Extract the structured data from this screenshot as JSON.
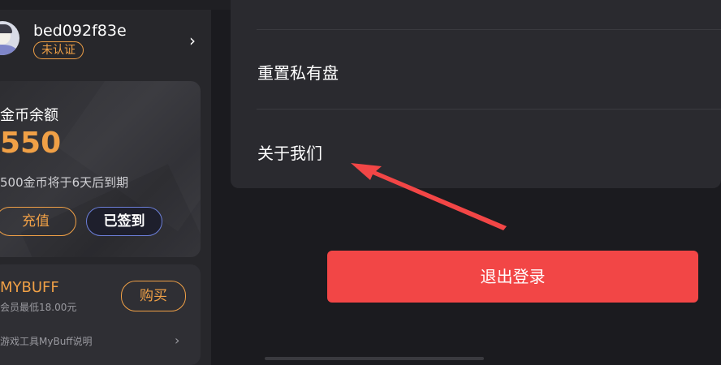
{
  "profile": {
    "username": "bed092f83e",
    "verify_badge": "未认证"
  },
  "wallet": {
    "label": "金币余额",
    "amount": "550",
    "expire_note": "500金币将于6天后到期",
    "recharge_label": "充值",
    "signed_label": "已签到",
    "accent_color": "#f0a046"
  },
  "buff": {
    "title": "MYBUFF",
    "price_note": "会员最低18.00元",
    "buy_label": "购买",
    "desc": "游戏工具MyBuff说明"
  },
  "menu": {
    "items": [
      {
        "label": "重置私有盘"
      },
      {
        "label": "关于我们"
      }
    ]
  },
  "logout": {
    "label": "退出登录",
    "color": "#f24646"
  },
  "annotation": {
    "arrow_color": "#f24646"
  }
}
